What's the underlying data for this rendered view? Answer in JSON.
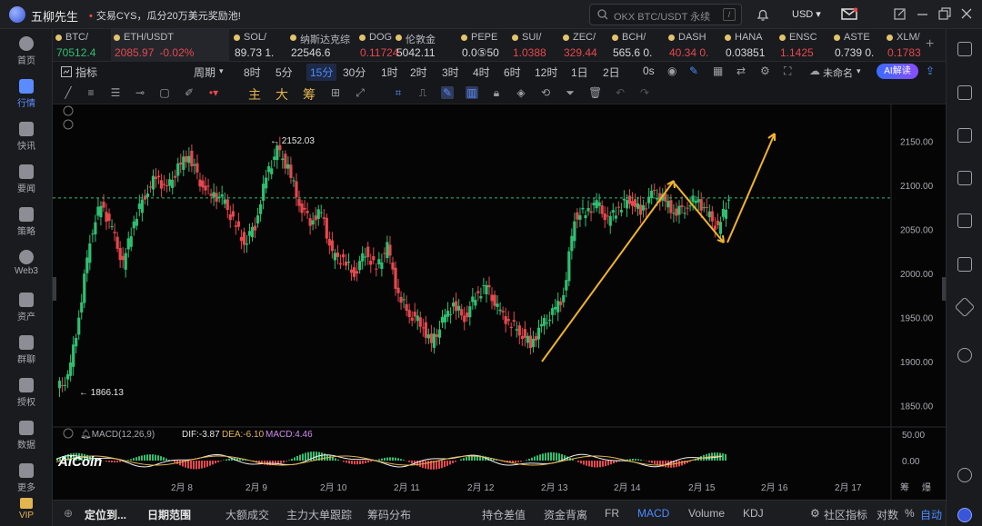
{
  "app": {
    "name": "五柳先生",
    "notice_icon": "•",
    "notice": "交易CYS，瓜分20万美元奖励池!"
  },
  "search": {
    "text": "OKX BTC/USDT 永续",
    "shortcut": "/"
  },
  "header": {
    "currency": "USD"
  },
  "sidebar": [
    {
      "label": "首页",
      "icon": "home-icon"
    },
    {
      "label": "行情",
      "icon": "market-icon",
      "active": true
    },
    {
      "label": "快讯",
      "icon": "news-flash-icon"
    },
    {
      "label": "要闻",
      "icon": "headline-icon"
    },
    {
      "label": "策略",
      "icon": "strategy-icon"
    },
    {
      "label": "Web3",
      "icon": "web3-icon"
    },
    {
      "label": "资产",
      "icon": "wallet-icon"
    },
    {
      "label": "群聊",
      "icon": "chat-icon"
    },
    {
      "label": "授权",
      "icon": "auth-icon"
    },
    {
      "label": "数据",
      "icon": "data-icon"
    },
    {
      "label": "更多",
      "icon": "more-icon"
    },
    {
      "label": "VIP",
      "icon": "vip-icon"
    }
  ],
  "tickers": [
    {
      "name": "BTC/",
      "price": "70512.4",
      "change": "",
      "dir": "up"
    },
    {
      "name": "ETH/USDT",
      "price": "2085.97",
      "change": "-0.02%",
      "dir": "dn",
      "active": true
    },
    {
      "name": "SOL/",
      "price": "89.73 1.",
      "change": "",
      "dir": "wt"
    },
    {
      "name": "纳斯达克综",
      "price": "22546.6",
      "change": "",
      "dir": "wt"
    },
    {
      "name": "DOG",
      "price": "0.11724",
      "change": "",
      "dir": "dn"
    },
    {
      "name": "伦敦金",
      "price": "5042.11",
      "change": "",
      "dir": "wt"
    },
    {
      "name": "PEPE",
      "price": "0.0⑤50",
      "change": "",
      "dir": "wt"
    },
    {
      "name": "SUI/",
      "price": "1.0388",
      "change": "",
      "dir": "dn"
    },
    {
      "name": "ZEC/",
      "price": "329.44",
      "change": "",
      "dir": "dn"
    },
    {
      "name": "BCH/",
      "price": "565.6 0.",
      "change": "",
      "dir": "wt"
    },
    {
      "name": "DASH",
      "price": "40.34 0.",
      "change": "",
      "dir": "dn"
    },
    {
      "name": "HANA",
      "price": "0.03851",
      "change": "",
      "dir": "wt"
    },
    {
      "name": "ENSC",
      "price": "1.1425",
      "change": "",
      "dir": "dn"
    },
    {
      "name": "ASTE",
      "price": "0.739 0.",
      "change": "",
      "dir": "wt"
    },
    {
      "name": "XLM/",
      "price": "0.1783",
      "change": "",
      "dir": "dn"
    }
  ],
  "toolbar": {
    "indicators": "指标",
    "period": "周期",
    "intervals": [
      "8时",
      "5分",
      "15分",
      "30分",
      "1时",
      "2时",
      "3时",
      "4时",
      "6时",
      "12时",
      "1日",
      "2日"
    ],
    "selected_interval": "15分",
    "zero_s": "0s",
    "unnamed": "未命名",
    "ai": "AI解读"
  },
  "drawbar": {
    "chars": [
      "主",
      "大",
      "筹"
    ]
  },
  "chart_data": {
    "type": "line",
    "price_ticks": [
      "2150.00",
      "2100.00",
      "2050.00",
      "2000.00",
      "1950.00",
      "1900.00",
      "1850.00"
    ],
    "price_ylim": [
      1826,
      2192
    ],
    "x_ticks": [
      "2月 8",
      "2月 9",
      "2月 10",
      "2月 11",
      "2月 12",
      "2月 13",
      "2月 14",
      "2月 15",
      "2月 16",
      "2月 17"
    ],
    "high_label": "2152.03",
    "low_label": "1866.13",
    "current_price": 2085.97,
    "close_series": [
      1870,
      1880,
      1950,
      2040,
      2080,
      2050,
      2010,
      2060,
      2090,
      2110,
      2095,
      2120,
      2135,
      2105,
      2090,
      2085,
      2060,
      2035,
      2055,
      2110,
      2140,
      2120,
      2080,
      2060,
      2070,
      2020,
      2015,
      2000,
      2025,
      2005,
      2030,
      1975,
      1955,
      1945,
      1920,
      1945,
      1965,
      1950,
      1975,
      1985,
      1960,
      1945,
      1935,
      1920,
      1940,
      1955,
      1975,
      2065,
      2070,
      2080,
      2060,
      2075,
      2085,
      2070,
      2090,
      2085,
      2070,
      2075,
      2085,
      2070,
      2050,
      2086
    ],
    "macd": {
      "label": "MACD(12,26,9)",
      "dif": "DIF:-3.87",
      "dea": "DEA:-6.10",
      "macd": "MACD:4.46",
      "ticks": [
        "50.00",
        "0.00"
      ]
    }
  },
  "watermark": "AiCoin",
  "bottom": {
    "items": [
      "定位到...",
      "日期范围",
      "大额成交",
      "主力大单跟踪",
      "筹码分布",
      "持仓差值",
      "资金背离",
      "FR",
      "MACD",
      "Volume",
      "KDJ",
      "社区指标",
      "对数",
      "%",
      "自动"
    ],
    "selected": "MACD",
    "right_labels": [
      "筹",
      "爆"
    ]
  },
  "colors": {
    "up": "#2fbf71",
    "down": "#e5484d",
    "accent": "#4d8bff",
    "arrow": "#f0b429"
  }
}
